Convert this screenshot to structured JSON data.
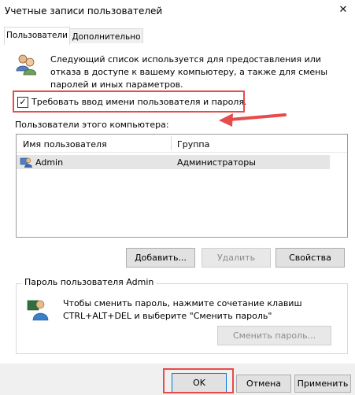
{
  "window": {
    "title": "Учетные записи пользователей"
  },
  "tabs": [
    {
      "label": "Пользователи",
      "active": true
    },
    {
      "label": "Дополнительно",
      "active": false
    }
  ],
  "description": "Следующий список используется для предоставления или отказа в доступе к вашему компьютеру, а также для смены паролей и иных параметров.",
  "checkbox": {
    "label": "Требовать ввод имени пользователя и пароля.",
    "checked": true
  },
  "users": {
    "label": "Пользователи этого компьютера:",
    "columns": [
      "Имя пользователя",
      "Группа"
    ],
    "rows": [
      {
        "name": "Admin",
        "group": "Администраторы"
      }
    ]
  },
  "buttons": {
    "add": "Добавить...",
    "remove": "Удалить",
    "properties": "Свойства",
    "change_password": "Сменить пароль...",
    "ok": "OK",
    "cancel": "Отмена",
    "apply": "Применить"
  },
  "password_group": {
    "title": "Пароль пользователя Admin",
    "text_line1": "Чтобы сменить пароль, нажмите сочетание клавиш",
    "text_line2": "CTRL+ALT+DEL и выберите \"Сменить пароль\""
  },
  "colors": {
    "highlight_red": "#e74c4c",
    "footer_bg": "#f0f0f0",
    "selected_row": "#e5e5e5"
  },
  "icons": [
    "users-icon",
    "user-icon",
    "admin-user-icon",
    "close-icon",
    "checkmark-icon",
    "red-arrow-icon"
  ]
}
